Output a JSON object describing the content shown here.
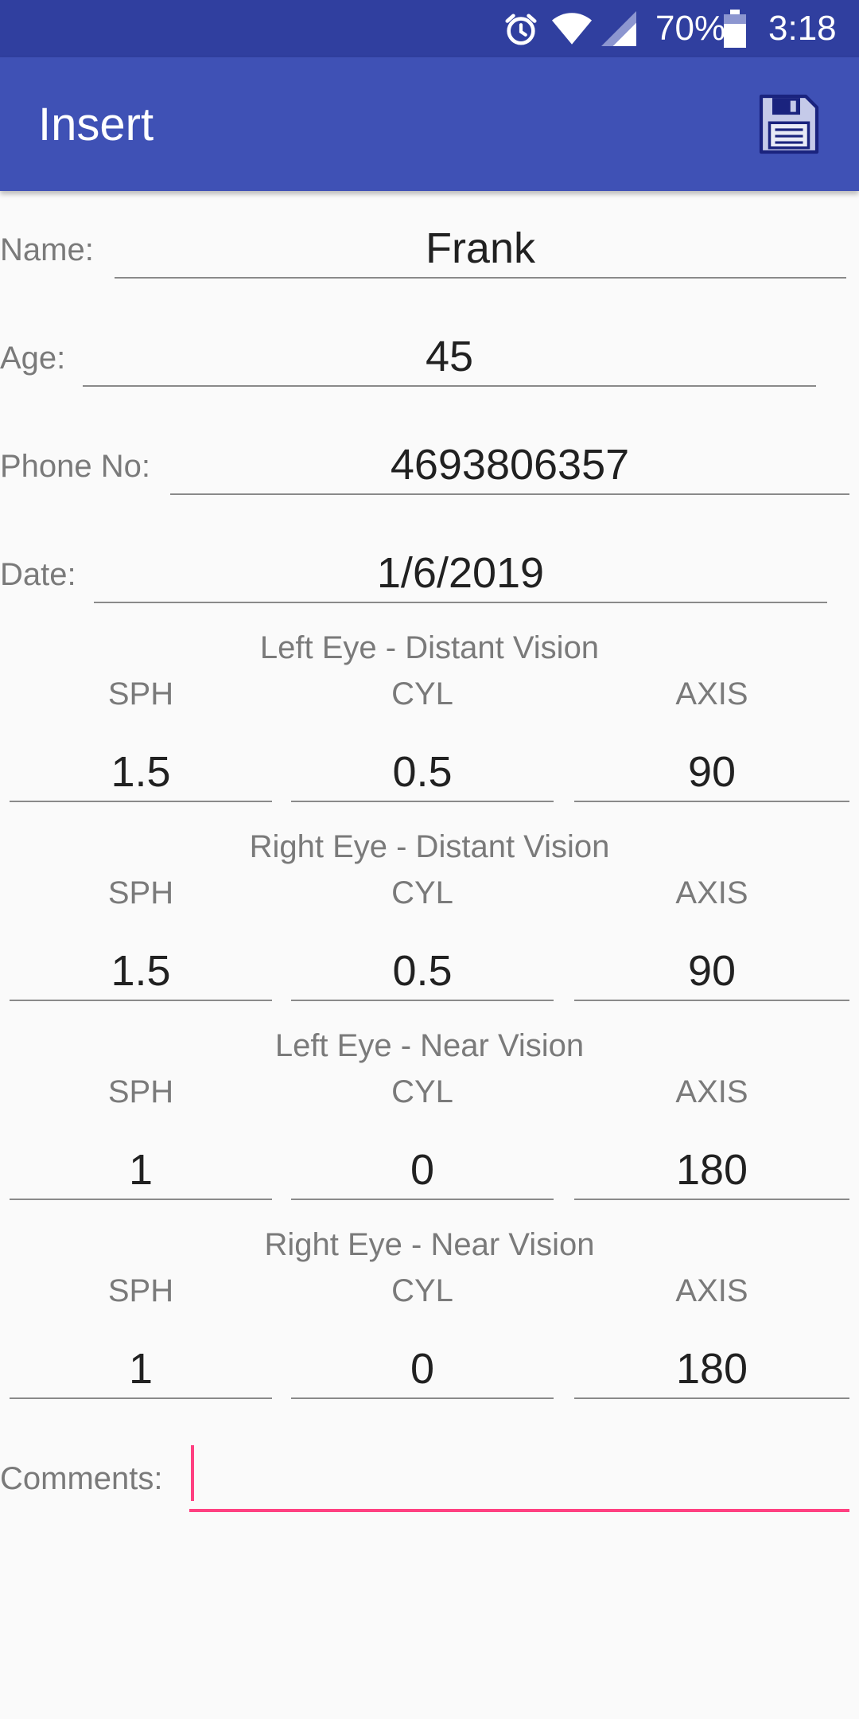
{
  "status_bar": {
    "battery_percent": "70%",
    "time": "3:18",
    "icons": [
      "alarm-icon",
      "wifi-icon",
      "cell-signal-icon",
      "battery-icon"
    ]
  },
  "app_bar": {
    "title": "Insert",
    "save_icon": "floppy-disk-save-icon"
  },
  "form": {
    "name": {
      "label": "Name:",
      "value": "Frank"
    },
    "age": {
      "label": "Age:",
      "value": "45"
    },
    "phone": {
      "label": "Phone No:",
      "value": "4693806357"
    },
    "date": {
      "label": "Date:",
      "value": "1/6/2019"
    },
    "columns": {
      "sph": "SPH",
      "cyl": "CYL",
      "axis": "AXIS"
    },
    "sections": [
      {
        "title": "Left Eye - Distant Vision",
        "sph": "1.5",
        "cyl": "0.5",
        "axis": "90"
      },
      {
        "title": "Right Eye - Distant Vision",
        "sph": "1.5",
        "cyl": "0.5",
        "axis": "90"
      },
      {
        "title": "Left Eye - Near Vision",
        "sph": "1",
        "cyl": "0",
        "axis": "180"
      },
      {
        "title": "Right Eye - Near Vision",
        "sph": "1",
        "cyl": "0",
        "axis": "180"
      }
    ],
    "comments": {
      "label": "Comments:",
      "value": ""
    }
  },
  "colors": {
    "primary": "#3f51b5",
    "primary_dark": "#303f9f",
    "accent": "#ff4081",
    "background": "#fafafa"
  }
}
